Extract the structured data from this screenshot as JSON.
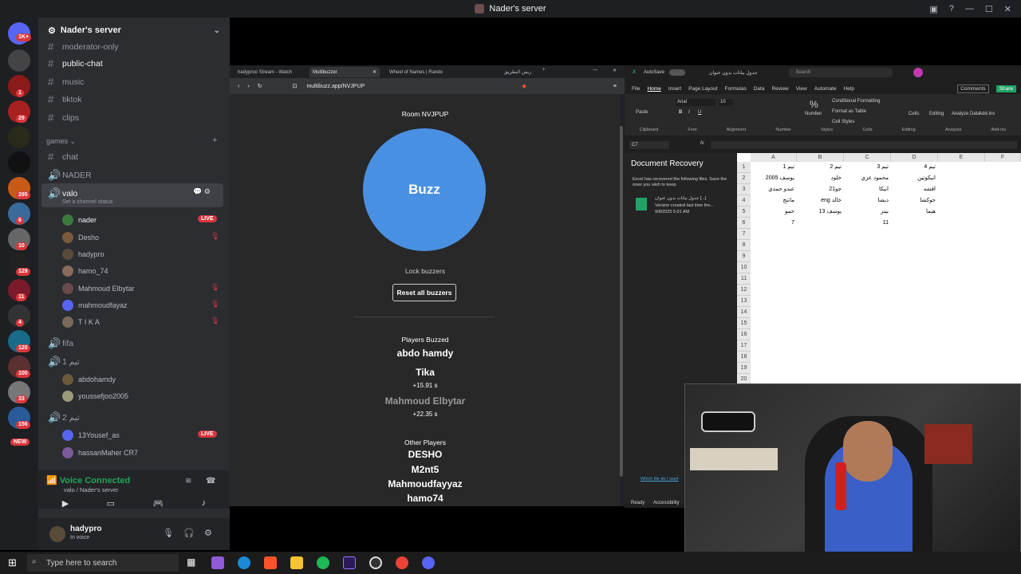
{
  "window": {
    "title": "Nader's server"
  },
  "rail": {
    "badges": [
      "1K+",
      "1",
      "29",
      "295",
      "6",
      "10",
      "129",
      "11",
      "4",
      "120",
      "100",
      "33",
      "156"
    ],
    "new_badge": "NEW"
  },
  "sidebar": {
    "server_name": "Nader's server",
    "channels_top": [
      {
        "name": "moderator-only",
        "type": "text"
      },
      {
        "name": "public-chat",
        "type": "text",
        "active": true
      },
      {
        "name": "music",
        "type": "text"
      },
      {
        "name": "tiktok",
        "type": "text"
      },
      {
        "name": "clips",
        "type": "text"
      }
    ],
    "category_games": "games",
    "games_channels": [
      {
        "name": "chat",
        "type": "text"
      },
      {
        "name": "NADER",
        "type": "voice"
      },
      {
        "name": "valo",
        "type": "voice",
        "active": true
      }
    ],
    "valo_status": "Set a channel status",
    "valo_users": [
      {
        "name": "nader",
        "live": "LIVE"
      },
      {
        "name": "Desho",
        "muted": true
      },
      {
        "name": "hadypro"
      },
      {
        "name": "hamo_74"
      },
      {
        "name": "Mahmoud Elbytar",
        "muted": true
      },
      {
        "name": "mahmoudfayaz",
        "muted": true
      },
      {
        "name": "T I K A",
        "muted": true
      }
    ],
    "fifa": "fifa",
    "team1": "تيم 1",
    "team1_users": [
      "abdohamdy",
      "youssefjoo2005"
    ],
    "team2": "تيم 2",
    "team2_users": [
      {
        "name": "13Yousef_as",
        "live": "LIVE"
      },
      {
        "name": "hassanMaher CR7"
      }
    ],
    "voice_connected": "Voice Connected",
    "voice_channel": "valo / Nader's server",
    "username": "hadypro",
    "user_status": "In voice"
  },
  "browser": {
    "tabs": [
      "hadyproo Stream - Watch",
      "Multibuzzer",
      "Wheel of Names | Rando",
      "ريش البطريق"
    ],
    "url": "multibuzz.app/NVJPUP",
    "room": "Room NVJPUP",
    "buzz": "Buzz",
    "lock": "Lock buzzers",
    "reset": "Reset all buzzers",
    "players_buzzed_title": "Players Buzzed",
    "buzzed": [
      {
        "name": "abdo hamdy",
        "time": ""
      },
      {
        "name": "Tika",
        "time": "+15.91 s"
      },
      {
        "name": "Mahmoud Elbytar",
        "time": "+22.35 s"
      }
    ],
    "other_players_title": "Other Players",
    "other_players": [
      "DESHO",
      "M2nt5",
      "Mahmoudfayyaz",
      "hamo74"
    ]
  },
  "excel": {
    "autosave": "AutoSave",
    "file_name": "جدول بيانات بدون عنوان",
    "search": "Search",
    "menu": [
      "File",
      "Home",
      "Insert",
      "Page Layout",
      "Formulas",
      "Data",
      "Review",
      "View",
      "Automate",
      "Help"
    ],
    "comments": "Comments",
    "share": "Share",
    "font": "Arial",
    "font_size": "10",
    "groups": [
      "Clipboard",
      "Font",
      "Alignment",
      "Number",
      "Styles",
      "Cells",
      "Editing",
      "Analysis",
      "Add-ins"
    ],
    "style_items": [
      "Conditional Formatting",
      "Format as Table",
      "Cell Styles"
    ],
    "cell_ref": "C7",
    "recovery_title": "Document Recovery",
    "recovery_text": "Excel has recovered the following files. Save the ones you wish to keep.",
    "recovery_file": "جدول بيانات بدون عنوان [...]",
    "recovery_version": "Version created last time the...",
    "recovery_date": "9/8/2025 5:01 AM",
    "which_file": "Which file do I want",
    "status": "Ready",
    "accessibility": "Accessibility",
    "columns": [
      "A",
      "B",
      "C",
      "D",
      "E",
      "F"
    ],
    "rows": [
      [
        "تيم 1",
        "تيم 2",
        "تيم 3",
        "تيم 4"
      ],
      [
        "يوسف 2005",
        "خلود",
        "محمود عزي",
        "انيكوتين"
      ],
      [
        "عبدو حمدي",
        "جو21",
        "انيكا",
        "افشه"
      ],
      [
        "مانتج",
        "eng خالد",
        "ديشا",
        "حوكشا"
      ],
      [
        "حمو",
        "يوسف 13",
        "بيتر",
        "هيما"
      ],
      [
        "7",
        "",
        "11",
        ""
      ]
    ],
    "row_count": 20
  },
  "taskbar": {
    "search_placeholder": "Type here to search"
  }
}
